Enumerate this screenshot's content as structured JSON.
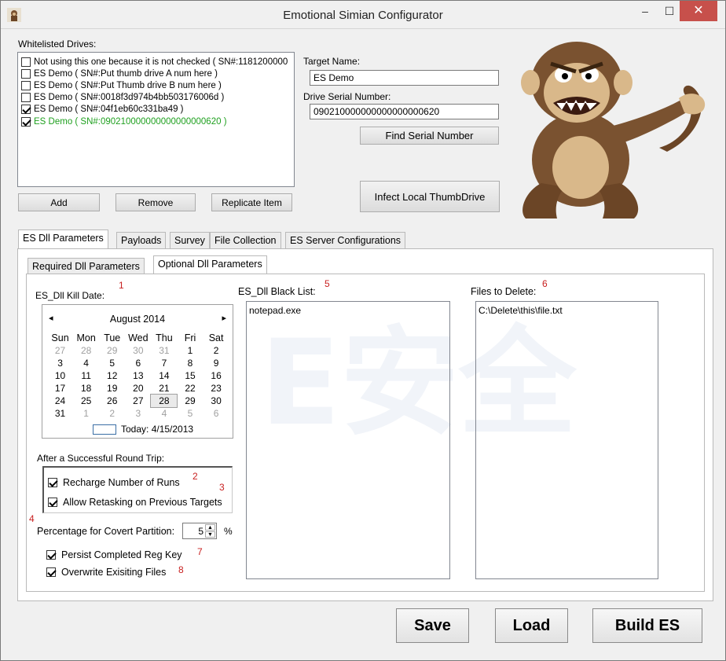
{
  "window": {
    "title": "Emotional Simian Configurator",
    "minimize": "–",
    "maximize": "☐",
    "close": "✕"
  },
  "drives": {
    "label": "Whitelisted Drives:",
    "items": [
      {
        "text": "Not using this one because it is not checked ( SN#:1181200000",
        "checked": false,
        "color": "#000000"
      },
      {
        "text": "ES Demo ( SN#:Put thumb drive A num here )",
        "checked": false,
        "color": "#000000"
      },
      {
        "text": "ES Demo ( SN#:Put Thumb drive B num here )",
        "checked": false,
        "color": "#000000"
      },
      {
        "text": "ES Demo ( SN#:0018f3d974b4bb503176006d )",
        "checked": false,
        "color": "#000000"
      },
      {
        "text": "ES Demo ( SN#:04f1eb60c331ba49 )",
        "checked": true,
        "color": "#000000"
      },
      {
        "text": "ES Demo ( SN#:090210000000000000000620 )",
        "checked": true,
        "color": "#1fa01f"
      }
    ],
    "add": "Add",
    "remove": "Remove",
    "replicate": "Replicate Item"
  },
  "target": {
    "name_label": "Target Name:",
    "name_value": "ES Demo",
    "serial_label": "Drive Serial Number:",
    "serial_value": "090210000000000000000620",
    "find_button": "Find Serial Number",
    "infect_button": "Infect Local ThumbDrive"
  },
  "tabs": [
    "ES Dll Parameters",
    "Payloads",
    "Survey",
    "File Collection",
    "ES Server Configurations"
  ],
  "subtabs": [
    "Required Dll Parameters",
    "Optional Dll Parameters"
  ],
  "options": {
    "kill_date_label": "ES_Dll Kill Date:",
    "calendar": {
      "month": "August 2014",
      "prev": "◂",
      "next": "▸",
      "days": [
        "Sun",
        "Mon",
        "Tue",
        "Wed",
        "Thu",
        "Fri",
        "Sat"
      ],
      "weeks": [
        [
          "27",
          "28",
          "29",
          "30",
          "31",
          "1",
          "2"
        ],
        [
          "3",
          "4",
          "5",
          "6",
          "7",
          "8",
          "9"
        ],
        [
          "10",
          "11",
          "12",
          "13",
          "14",
          "15",
          "16"
        ],
        [
          "17",
          "18",
          "19",
          "20",
          "21",
          "22",
          "23"
        ],
        [
          "24",
          "25",
          "26",
          "27",
          "28",
          "29",
          "30"
        ],
        [
          "31",
          "1",
          "2",
          "3",
          "4",
          "5",
          "6"
        ]
      ],
      "today": "Today: 4/15/2013"
    },
    "round_trip_label": "After a Successful Round Trip:",
    "recharge": "Recharge Number of Runs",
    "retask": "Allow Retasking on Previous Targets",
    "covert_label": "Percentage for Covert Partition:",
    "covert_value": "5",
    "percent": "%",
    "persist": "Persist Completed Reg Key",
    "overwrite": "Overwrite Exisiting Files",
    "blacklist_label": "ES_Dll Black List:",
    "blacklist_items": [
      "notepad.exe"
    ],
    "delete_label": "Files to Delete:",
    "delete_items": [
      "C:\\Delete\\this\\file.txt"
    ],
    "markers": [
      "1",
      "2",
      "3",
      "4",
      "5",
      "6",
      "7",
      "8"
    ]
  },
  "footer": {
    "save": "Save",
    "load": "Load",
    "build": "Build ES"
  },
  "watermark": "E安全"
}
